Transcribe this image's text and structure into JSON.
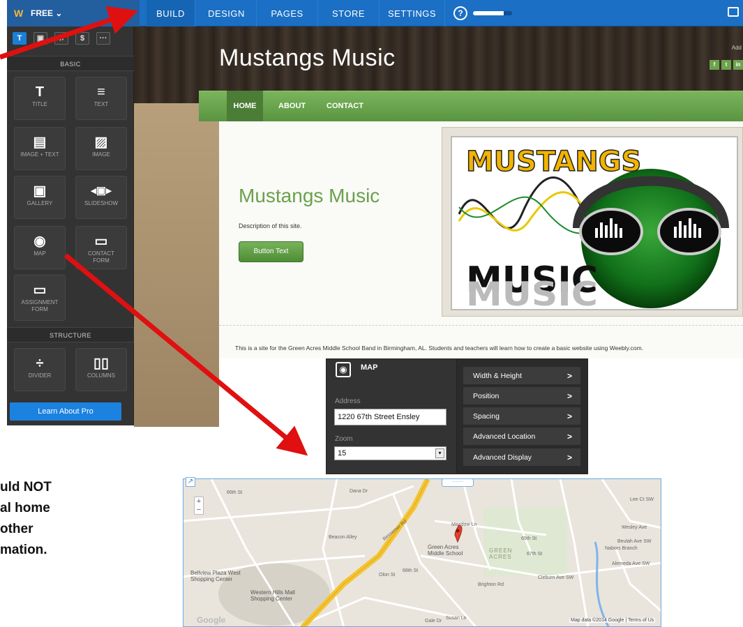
{
  "topbar": {
    "plan_label": "FREE ⌄",
    "tabs": [
      {
        "label": "BUILD",
        "active": true
      },
      {
        "label": "DESIGN"
      },
      {
        "label": "PAGES"
      },
      {
        "label": "STORE"
      },
      {
        "label": "SETTINGS"
      }
    ],
    "help_icon": "help-circle-icon",
    "progress_fraction": 0.78
  },
  "sidebar": {
    "icon_tabs": [
      "T",
      "▣",
      "♫",
      "$",
      "···"
    ],
    "basic_header": "BASIC",
    "basic_items": [
      {
        "label": "TITLE",
        "icon": "T"
      },
      {
        "label": "TEXT",
        "icon": "≡"
      },
      {
        "label": "IMAGE + TEXT",
        "icon": "▤"
      },
      {
        "label": "IMAGE",
        "icon": "▨"
      },
      {
        "label": "GALLERY",
        "icon": "▣"
      },
      {
        "label": "SLIDESHOW",
        "icon": "◂▣▸"
      },
      {
        "label": "MAP",
        "icon": "◉"
      },
      {
        "label": "CONTACT FORM",
        "icon": "▭"
      },
      {
        "label": "ASSIGNMENT FORM",
        "icon": "▭"
      }
    ],
    "structure_header": "STRUCTURE",
    "structure_items": [
      {
        "label": "DIVIDER",
        "icon": "÷"
      },
      {
        "label": "COLUMNS",
        "icon": "▯▯"
      }
    ],
    "learn_pro": "Learn About Pro"
  },
  "site": {
    "title": "Mustangs Music",
    "header_add": "Add",
    "social": [
      "f",
      "t",
      "in"
    ],
    "nav": [
      "HOME",
      "ABOUT",
      "CONTACT"
    ],
    "heading": "Mustangs Music",
    "description": "Description of this site.",
    "button": "Button Text",
    "logo_top": "MUSTANGS",
    "logo_bottom": "MUSIC",
    "footer_text": "This is a site for the Green Acres Middle School Band in Birmingham, AL.  Students and teachers will learn how to create a basic website using Weebly.com."
  },
  "map_panel": {
    "title": "MAP",
    "address_label": "Address",
    "address_value": "1220 67th Street Ensley",
    "zoom_label": "Zoom",
    "zoom_value": "15",
    "menu": [
      "Width & Height",
      "Position",
      "Spacing",
      "Advanced Location",
      "Advanced Display"
    ]
  },
  "map": {
    "labels": [
      "Bellview Plaza West Shopping Center",
      "Western Hills Mall Shopping Center",
      "Green Acres Middle School",
      "GREEN ACRES",
      "Meadow Ln",
      "Brighton Rd",
      "Cleburn Ave SW",
      "Olon St",
      "Beacon Alley",
      "Bessemer Rd",
      "Nabors Branch",
      "Wesley Ave",
      "Beulah Ave SW",
      "Alemeda Ave SW",
      "Lee Ct SW",
      "65th St",
      "66th St",
      "68th St",
      "67th St",
      "Dana Dr",
      "Gale Dr",
      "Susan Ln"
    ],
    "credit": "Map data ©2014 Google  |  Terms of Us",
    "google": "Google"
  },
  "annotation": {
    "lines": [
      "uld NOT",
      "al home",
      "other",
      "mation."
    ]
  }
}
